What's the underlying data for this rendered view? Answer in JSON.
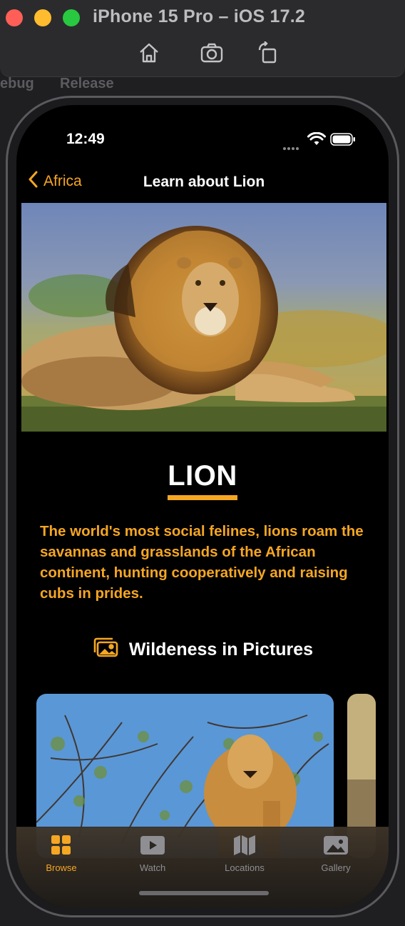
{
  "window": {
    "title": "iPhone 15 Pro – iOS 17.2",
    "toolbar": {
      "home_icon": "home-icon",
      "screenshot_icon": "camera-icon",
      "rotate_icon": "rotate-icon"
    }
  },
  "background": {
    "tab_left": "ebug",
    "tab_right": "Release"
  },
  "status_bar": {
    "time": "12:49"
  },
  "nav": {
    "back_label": "Africa",
    "title": "Learn about Lion"
  },
  "animal": {
    "name": "LION",
    "description": "The world's most social felines, lions roam the savannas and grasslands of the African continent, hunting cooperatively and raising cubs in prides."
  },
  "gallery_section": {
    "title": "Wildeness in Pictures",
    "icon": "photo-stack-icon"
  },
  "tabs": [
    {
      "label": "Browse",
      "icon": "grid-icon",
      "active": true
    },
    {
      "label": "Watch",
      "icon": "play-icon",
      "active": false
    },
    {
      "label": "Locations",
      "icon": "map-icon",
      "active": false
    },
    {
      "label": "Gallery",
      "icon": "photo-icon",
      "active": false
    }
  ],
  "colors": {
    "accent": "#f5a623",
    "background": "#000000",
    "inactive_tab": "#8e8e93"
  }
}
